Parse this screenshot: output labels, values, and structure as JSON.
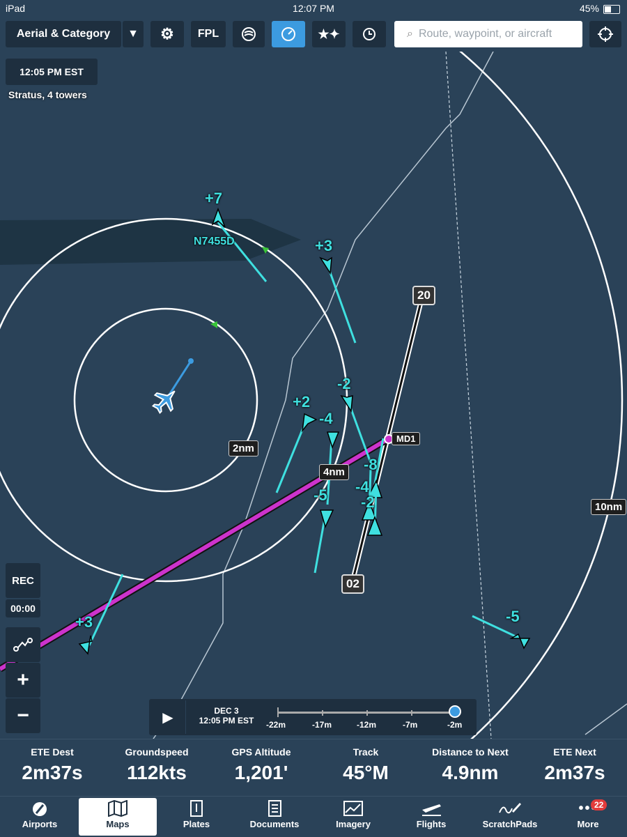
{
  "status_bar": {
    "device": "iPad",
    "time": "12:07 PM",
    "battery": "45%",
    "battery_fraction": 0.45
  },
  "toolbar": {
    "layer_label": "Aerial & Category",
    "fpl_label": "FPL",
    "search_placeholder": "Route, waypoint, or aircraft"
  },
  "map": {
    "time_label": "12:05 PM EST",
    "source_label": "Stratus, 4 towers",
    "traffic": [
      {
        "alt": "+7",
        "tag": "N7455D"
      },
      {
        "alt": "+3"
      },
      {
        "alt": "-2"
      },
      {
        "alt": "+2"
      },
      {
        "alt": "-4"
      },
      {
        "alt": "-8"
      },
      {
        "alt": "-4"
      },
      {
        "alt": "-5"
      },
      {
        "alt": "-2"
      },
      {
        "alt": "+3"
      },
      {
        "alt": "-5"
      }
    ],
    "ring_labels": {
      "inner": "2nm",
      "middle": "4nm",
      "outer": "10nm"
    },
    "runway": {
      "end_a": "20",
      "end_b": "02"
    },
    "waypoint": "MD1",
    "rec_label": "REC",
    "rec_time": "00:00"
  },
  "timeline": {
    "date": "DEC 3",
    "time": "12:05 PM EST",
    "ticks": [
      "-22m",
      "-17m",
      "-12m",
      "-7m",
      "-2m"
    ]
  },
  "info": [
    {
      "title": "ETE Dest",
      "value": "2m37s"
    },
    {
      "title": "Groundspeed",
      "value": "112kts"
    },
    {
      "title": "GPS Altitude",
      "value": "1,201'"
    },
    {
      "title": "Track",
      "value": "45°M"
    },
    {
      "title": "Distance to Next",
      "value": "4.9nm"
    },
    {
      "title": "ETE Next",
      "value": "2m37s"
    }
  ],
  "tabs": [
    {
      "label": "Airports",
      "icon": "airports-icon"
    },
    {
      "label": "Maps",
      "icon": "maps-icon"
    },
    {
      "label": "Plates",
      "icon": "plates-icon"
    },
    {
      "label": "Documents",
      "icon": "documents-icon"
    },
    {
      "label": "Imagery",
      "icon": "imagery-icon"
    },
    {
      "label": "Flights",
      "icon": "flights-icon"
    },
    {
      "label": "ScratchPads",
      "icon": "scratchpads-icon"
    },
    {
      "label": "More",
      "icon": "more-icon",
      "badge": "22"
    }
  ],
  "colors": {
    "background": "#2a4258",
    "traffic": "#3fe0e0",
    "route": "#cc33cc",
    "accent": "#3c9be0"
  }
}
